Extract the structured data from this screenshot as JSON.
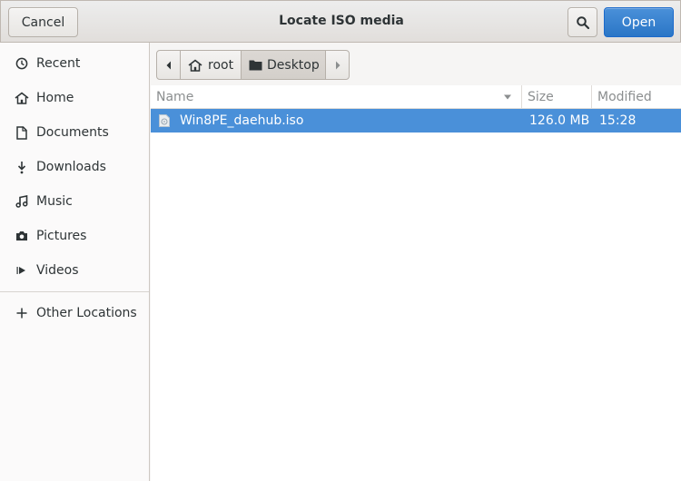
{
  "header": {
    "title": "Locate ISO media",
    "cancel_label": "Cancel",
    "open_label": "Open"
  },
  "sidebar": {
    "items": [
      {
        "label": "Recent",
        "icon": "clock-icon"
      },
      {
        "label": "Home",
        "icon": "home-icon"
      },
      {
        "label": "Documents",
        "icon": "document-icon"
      },
      {
        "label": "Downloads",
        "icon": "download-icon"
      },
      {
        "label": "Music",
        "icon": "music-icon"
      },
      {
        "label": "Pictures",
        "icon": "camera-icon"
      },
      {
        "label": "Videos",
        "icon": "video-icon"
      },
      {
        "label": "Other Locations",
        "icon": "plus-icon"
      }
    ]
  },
  "pathbar": {
    "segments": [
      {
        "label": "root",
        "icon": "home-icon"
      },
      {
        "label": "Desktop",
        "icon": "folder-icon"
      }
    ]
  },
  "columns": {
    "name": "Name",
    "size": "Size",
    "modified": "Modified"
  },
  "files": [
    {
      "name": "Win8PE_daehub.iso",
      "size": "126.0 MB",
      "modified": "15:28",
      "icon": "disc-image-icon",
      "selected": true
    }
  ],
  "colors": {
    "accent": "#4a90d9",
    "sidebar_bg": "#fbfafa",
    "header_bg": "#e8e6e3"
  }
}
